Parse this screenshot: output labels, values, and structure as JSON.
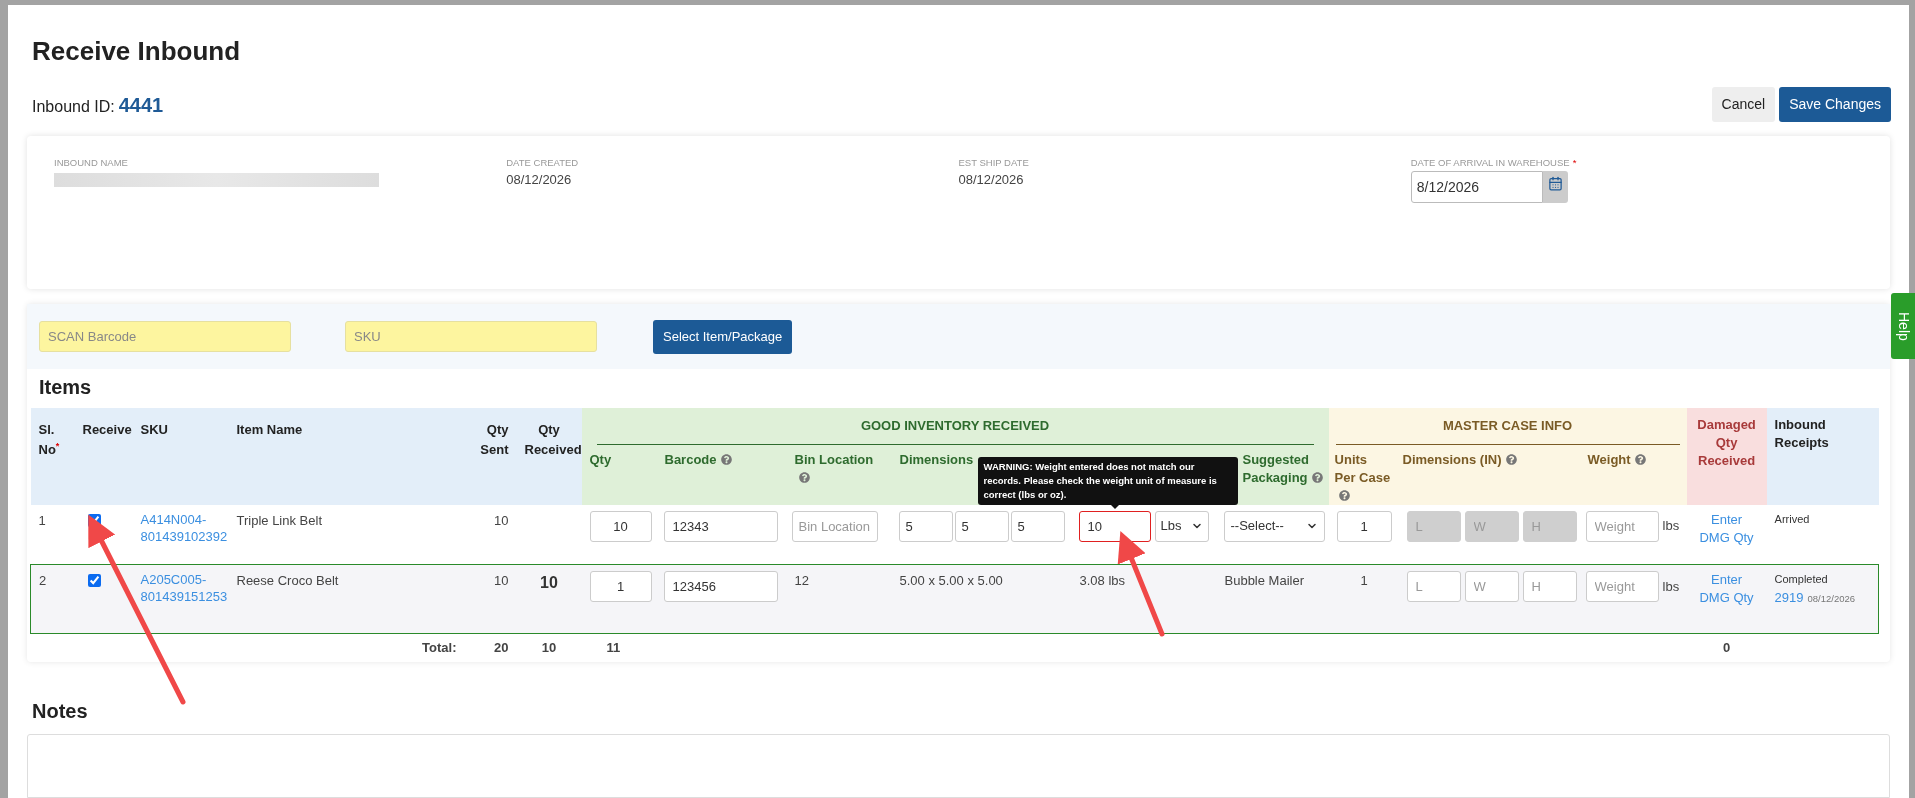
{
  "page": {
    "title": "Receive Inbound",
    "inbound_id_label": "Inbound ID:",
    "inbound_id": "4441"
  },
  "actions": [
    {
      "label": "Cancel",
      "kind": "secondary"
    },
    {
      "label": "Save Changes",
      "kind": "primary"
    }
  ],
  "info": [
    {
      "label": "INBOUND NAME",
      "kind": "redacted"
    },
    {
      "label": "DATE CREATED",
      "kind": "text",
      "value": "08/12/2026"
    },
    {
      "label": "EST SHIP DATE",
      "kind": "text",
      "value": "08/12/2026"
    },
    {
      "label": "DATE OF ARRIVAL IN WAREHOUSE",
      "kind": "date",
      "required_mark": "*",
      "value": "8/12/2026"
    }
  ],
  "scan": {
    "barcode_placeholder": "SCAN Barcode",
    "sku_placeholder": "SKU",
    "button": "Select Item/Package"
  },
  "help_tab": "Help",
  "items": {
    "title": "Items",
    "left_columns": [
      {
        "label": "Sl. No",
        "required_mark": "*"
      },
      {
        "label": "Receive"
      },
      {
        "label": "SKU"
      },
      {
        "label": "Item Name"
      },
      {
        "label": "Qty Sent"
      },
      {
        "label": "Qty Received"
      }
    ],
    "good_group": {
      "title": "GOOD INVENTORY RECEIVED",
      "columns": [
        {
          "label": "Qty",
          "help": false
        },
        {
          "label": "Barcode",
          "help": true
        },
        {
          "label": "Bin Location",
          "help": true
        },
        {
          "label": "Dimensions",
          "help": false
        },
        {
          "label": "Suggested Packaging",
          "help": true
        }
      ]
    },
    "master_group": {
      "title": "MASTER CASE INFO",
      "columns": [
        {
          "label": "Units Per Case",
          "help": true
        },
        {
          "label": "Dimensions (IN)",
          "help": true
        },
        {
          "label": "Weight",
          "help": true
        }
      ]
    },
    "damaged_header": "Damaged Qty Received",
    "receipts_header": "Inbound Receipts",
    "rows": [
      {
        "sl": "1",
        "checked": true,
        "editing": true,
        "highlighted": false,
        "sku": "A414N004-801439102392",
        "name": "Triple Link Belt",
        "qty_sent": "10",
        "qty": "10",
        "barcode": "12343",
        "bin_placeholder": "Bin Location",
        "dims": [
          "5",
          "5",
          "5"
        ],
        "weight": "10",
        "weight_error": true,
        "weight_warning": "WARNING: Weight entered does not match our records. Please check the weight unit of measure is correct (lbs or oz).",
        "weight_unit": "Lbs",
        "packaging": "--Select--",
        "units_per_case": "1",
        "case_dims_placeholders": [
          "L",
          "W",
          "H"
        ],
        "case_dims_disabled": true,
        "case_weight_placeholder": "Weight",
        "case_weight_unit": "lbs",
        "damaged": "Enter DMG Qty",
        "receipt_status": "Arrived"
      },
      {
        "sl": "2",
        "checked": true,
        "editing": false,
        "highlighted": true,
        "sku": "A205C005-801439151253",
        "name": "Reese Croco Belt",
        "qty_sent": "10",
        "qty_received": "10",
        "qty": "1",
        "barcode": "123456",
        "bin": "12",
        "dims_text": "5.00 x 5.00 x 5.00",
        "weight_text": "3.08 lbs",
        "packaging": "Bubble Mailer",
        "units_per_case": "1",
        "case_dims_placeholders": [
          "L",
          "W",
          "H"
        ],
        "case_dims_disabled": false,
        "case_weight_placeholder": "Weight",
        "case_weight_unit": "lbs",
        "damaged": "Enter DMG Qty",
        "receipt_status": "Completed",
        "receipt_link": "2919",
        "receipt_date": "08/12/2026"
      }
    ],
    "totals": {
      "label": "Total:",
      "qty_sent": "20",
      "qty_received": "10",
      "qty": "11",
      "damaged": "0"
    }
  },
  "notes": {
    "title": "Notes"
  }
}
